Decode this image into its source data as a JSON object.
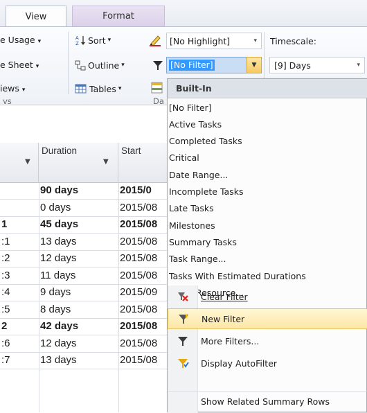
{
  "tabs": {
    "view": "View",
    "format": "Format"
  },
  "ribbon": {
    "row1": {
      "resource_usage": "e Usage",
      "sort": "Sort",
      "highlight_value": "[No Highlight]",
      "timescale_label": "Timescale:"
    },
    "row2": {
      "resource_sheet": "e Sheet",
      "outline": "Outline",
      "filter_value": "[No Filter]",
      "timescale_value": "[9] Days"
    },
    "row3": {
      "views": "iews",
      "tables": "Tables"
    },
    "group_labels": {
      "resource_views": "vs",
      "data": "Da"
    }
  },
  "grid": {
    "columns": {
      "duration": "Duration",
      "start": "Start"
    },
    "rows": [
      {
        "id": "",
        "duration": "90 days",
        "start": "2015/0",
        "bold": true
      },
      {
        "id": "",
        "duration": "0 days",
        "start": "2015/08",
        "bold": false
      },
      {
        "id": "1",
        "duration": "45 days",
        "start": "2015/08",
        "bold": true
      },
      {
        "id": ":1",
        "duration": "13 days",
        "start": "2015/08",
        "bold": false
      },
      {
        "id": ":2",
        "duration": "12 days",
        "start": "2015/08",
        "bold": false
      },
      {
        "id": ":3",
        "duration": "11 days",
        "start": "2015/08",
        "bold": false
      },
      {
        "id": ":4",
        "duration": "9 days",
        "start": "2015/09",
        "bold": false
      },
      {
        "id": ":5",
        "duration": "8 days",
        "start": "2015/08",
        "bold": false
      },
      {
        "id": "2",
        "duration": "42 days",
        "start": "2015/08",
        "bold": true
      },
      {
        "id": ":6",
        "duration": "12 days",
        "start": "2015/08",
        "bold": false
      },
      {
        "id": ":7",
        "duration": "13 days",
        "start": "2015/08",
        "bold": false
      }
    ]
  },
  "filter_menu": {
    "header": "Built-In",
    "items": [
      "[No Filter]",
      "Active Tasks",
      "Completed Tasks",
      "Critical",
      "Date Range...",
      "Incomplete Tasks",
      "Late Tasks",
      "Milestones",
      "Summary Tasks",
      "Task Range...",
      "Tasks With Estimated Durations",
      "Using Resource..."
    ],
    "commands": {
      "clear_filter": "Clear Filter",
      "new_filter": "New Filter",
      "more_filters": "More Filters...",
      "display_autofilter": "Display AutoFilter",
      "show_related": "Show Related Summary Rows"
    }
  },
  "colors": {
    "accent": "#3399ff",
    "hover": "#fde7a6",
    "menu_header": "#dde2e8"
  }
}
